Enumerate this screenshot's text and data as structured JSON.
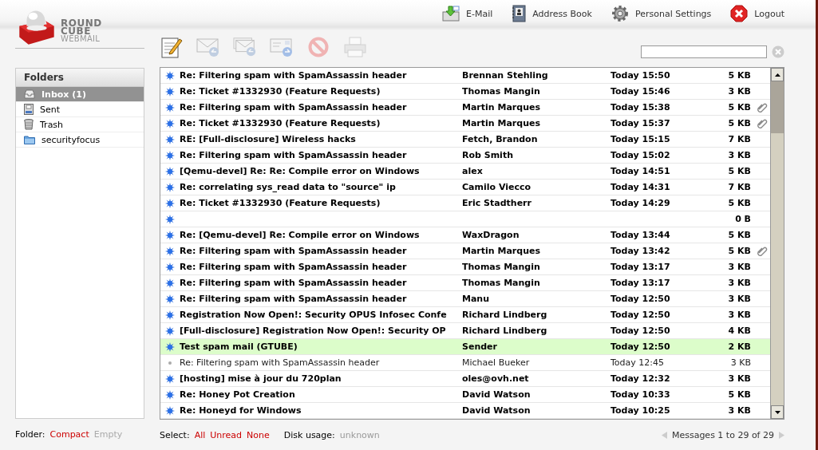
{
  "logo": {
    "line_1": "ROUND",
    "line_2": "CUBE",
    "line_3": "WEBMAIL"
  },
  "nav": [
    {
      "kind": "mail",
      "label": "E-Mail"
    },
    {
      "kind": "addressbook",
      "label": "Address Book"
    },
    {
      "kind": "settings",
      "label": "Personal Settings"
    },
    {
      "kind": "logout",
      "label": "Logout"
    }
  ],
  "toolbar": [
    {
      "kind": "compose",
      "disabled": false
    },
    {
      "kind": "reply",
      "disabled": true
    },
    {
      "kind": "reply_all",
      "disabled": true
    },
    {
      "kind": "forward",
      "disabled": true
    },
    {
      "kind": "delete",
      "disabled": true
    },
    {
      "kind": "print",
      "disabled": true
    }
  ],
  "folders": {
    "title": "Folders",
    "items": [
      {
        "kind": "inbox",
        "label": "Inbox (1)",
        "selected": true
      },
      {
        "kind": "sent",
        "label": "Sent",
        "selected": false
      },
      {
        "kind": "trash",
        "label": "Trash",
        "selected": false
      },
      {
        "kind": "folder",
        "label": "securityfocus",
        "selected": false
      }
    ]
  },
  "messages": [
    {
      "subject": "Re: Filtering spam with SpamAssassin header",
      "from": "Brennan Stehling",
      "date": "Today 15:50",
      "size": "5 KB",
      "unread": true,
      "attachment": false,
      "selected": false
    },
    {
      "subject": "Re: Ticket #1332930 (Feature Requests)",
      "from": "Thomas Mangin",
      "date": "Today 15:46",
      "size": "3 KB",
      "unread": true,
      "attachment": false,
      "selected": false
    },
    {
      "subject": "Re: Filtering spam with SpamAssassin header",
      "from": "Martin Marques",
      "date": "Today 15:38",
      "size": "5 KB",
      "unread": true,
      "attachment": true,
      "selected": false
    },
    {
      "subject": "Re: Ticket #1332930 (Feature Requests)",
      "from": "Martin Marques",
      "date": "Today 15:37",
      "size": "5 KB",
      "unread": true,
      "attachment": true,
      "selected": false
    },
    {
      "subject": "RE: [Full-disclosure] Wireless hacks",
      "from": "Fetch, Brandon",
      "date": "Today 15:15",
      "size": "7 KB",
      "unread": true,
      "attachment": false,
      "selected": false
    },
    {
      "subject": "Re: Filtering spam with SpamAssassin header",
      "from": "Rob Smith",
      "date": "Today 15:02",
      "size": "3 KB",
      "unread": true,
      "attachment": false,
      "selected": false
    },
    {
      "subject": "[Qemu-devel] Re: Re: Compile error on Windows",
      "from": "alex",
      "date": "Today 14:51",
      "size": "5 KB",
      "unread": true,
      "attachment": false,
      "selected": false
    },
    {
      "subject": "Re: correlating sys_read data to \"source\" ip",
      "from": "Camilo Viecco",
      "date": "Today 14:31",
      "size": "7 KB",
      "unread": true,
      "attachment": false,
      "selected": false
    },
    {
      "subject": "Re: Ticket #1332930 (Feature Requests)",
      "from": "Eric Stadtherr",
      "date": "Today 14:29",
      "size": "5 KB",
      "unread": true,
      "attachment": false,
      "selected": false
    },
    {
      "size": "0 B",
      "unread": true,
      "attachment": false,
      "selected": false
    },
    {
      "subject": "Re: [Qemu-devel] Re: Compile error on Windows",
      "from": "WaxDragon",
      "date": "Today 13:44",
      "size": "5 KB",
      "unread": true,
      "attachment": false,
      "selected": false
    },
    {
      "subject": "Re: Filtering spam with SpamAssassin header",
      "from": "Martin Marques",
      "date": "Today 13:42",
      "size": "5 KB",
      "unread": true,
      "attachment": true,
      "selected": false
    },
    {
      "subject": "Re: Filtering spam with SpamAssassin header",
      "from": "Thomas Mangin",
      "date": "Today 13:17",
      "size": "3 KB",
      "unread": true,
      "attachment": false,
      "selected": false
    },
    {
      "subject": "Re: Filtering spam with SpamAssassin header",
      "from": "Thomas Mangin",
      "date": "Today 13:17",
      "size": "3 KB",
      "unread": true,
      "attachment": false,
      "selected": false
    },
    {
      "subject": "Re: Filtering spam with SpamAssassin header",
      "from": "Manu",
      "date": "Today 12:50",
      "size": "3 KB",
      "unread": true,
      "attachment": false,
      "selected": false
    },
    {
      "subject": "Registration Now Open!: Security OPUS Infosec Confe",
      "from": "Richard Lindberg",
      "date": "Today 12:50",
      "size": "3 KB",
      "unread": true,
      "attachment": false,
      "selected": false
    },
    {
      "subject": "[Full-disclosure] Registration Now Open!: Security OP",
      "from": "Richard Lindberg",
      "date": "Today 12:50",
      "size": "4 KB",
      "unread": true,
      "attachment": false,
      "selected": false
    },
    {
      "subject": "Test spam mail (GTUBE)",
      "from": "Sender",
      "date": "Today 12:50",
      "size": "2 KB",
      "unread": true,
      "attachment": false,
      "selected": true
    },
    {
      "subject": "Re: Filtering spam with SpamAssassin header",
      "from": "Michael Bueker",
      "date": "Today 12:45",
      "size": "3 KB",
      "unread": false,
      "attachment": false,
      "selected": false
    },
    {
      "subject": "[hosting] mise à jour du 720plan",
      "from": "oles@ovh.net",
      "date": "Today 12:32",
      "size": "3 KB",
      "unread": true,
      "attachment": false,
      "selected": false
    },
    {
      "subject": "Re: Honey Pot Creation",
      "from": "David Watson",
      "date": "Today 10:33",
      "size": "5 KB",
      "unread": true,
      "attachment": false,
      "selected": false
    },
    {
      "subject": "Re: Honeyd for Windows",
      "from": "David Watson",
      "date": "Today 10:25",
      "size": "3 KB",
      "unread": true,
      "attachment": false,
      "selected": false
    }
  ],
  "folder_footer": {
    "label": "Folder:",
    "actions": [
      {
        "label": "Compact",
        "disabled": false
      },
      {
        "label": "Empty",
        "disabled": true
      }
    ]
  },
  "list_footer": {
    "select_label": "Select:",
    "select_actions": [
      {
        "label": "All",
        "disabled": false
      },
      {
        "label": "Unread",
        "disabled": false
      },
      {
        "label": "None",
        "disabled": false
      }
    ],
    "disk_label": "Disk usage:",
    "disk_value": "unknown",
    "count": "Messages 1 to 29 of 29"
  }
}
